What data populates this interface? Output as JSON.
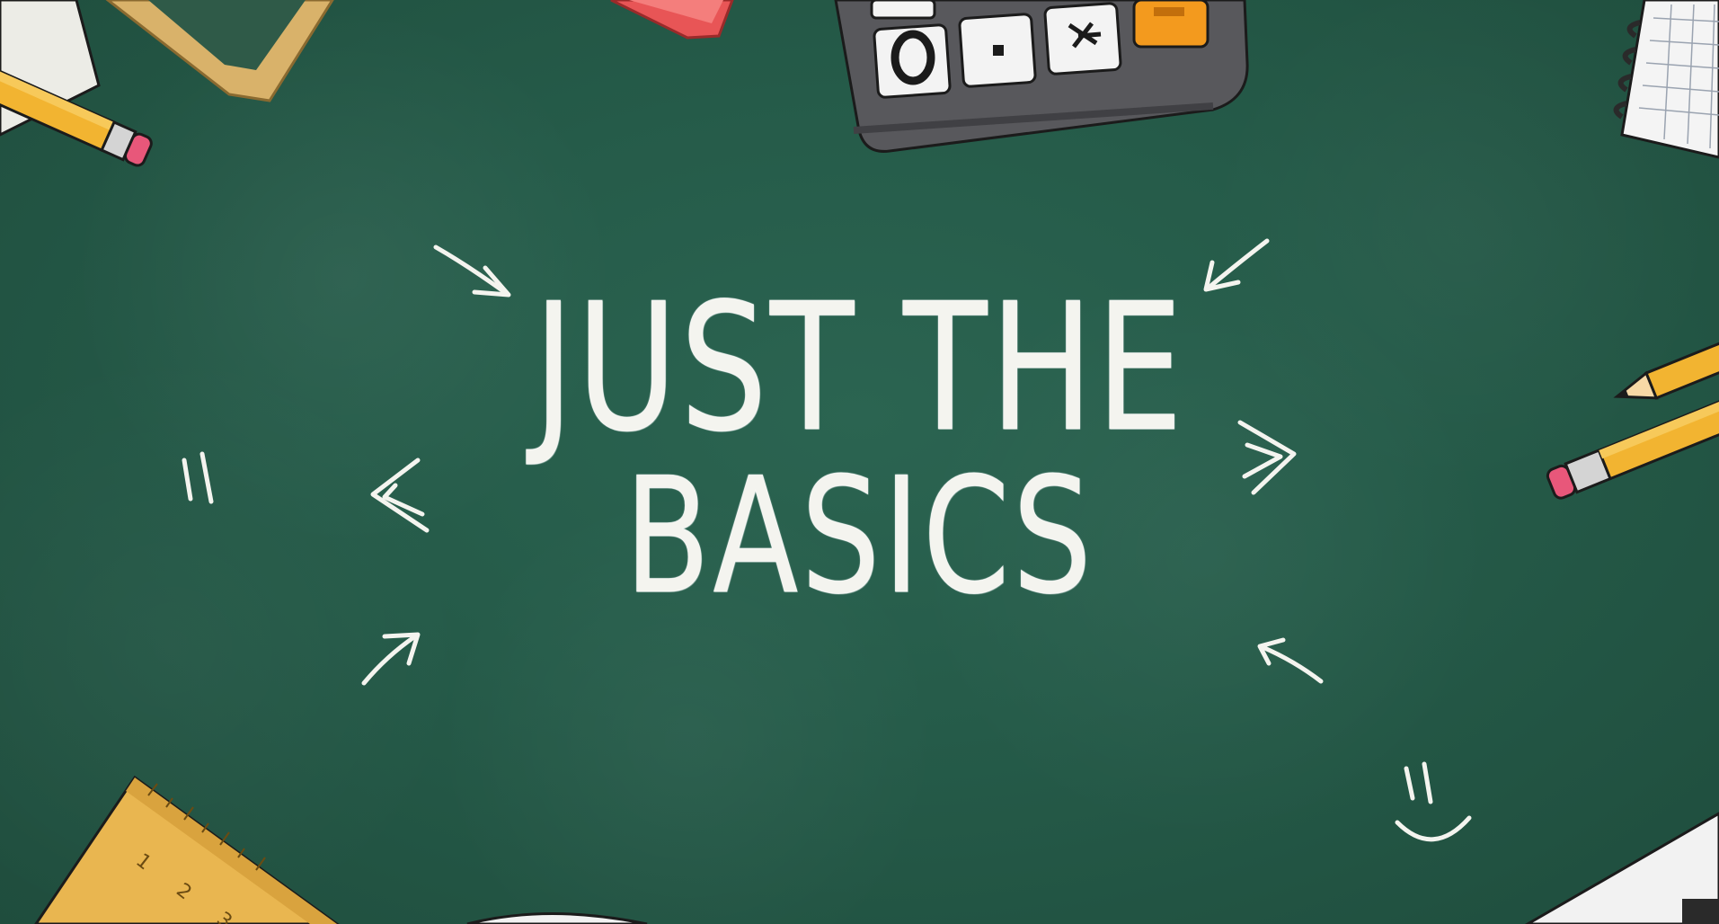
{
  "title": {
    "line1": "JUST THE",
    "line2": "BASICS"
  },
  "decorations": {
    "calculator_keys": [
      "0",
      "",
      "",
      ""
    ],
    "ruler_numbers": [
      "1",
      "2",
      "3"
    ]
  },
  "colors": {
    "chalkboard": "#245546",
    "chalk": "#f4f4ef",
    "pencil": "#f2b431",
    "eraser": "#e8577a",
    "calculator_body": "#5a5a5e",
    "calculator_accent": "#f39a1e",
    "ruler": "#e9b650"
  },
  "icons": [
    "pencil-icon",
    "calculator-icon",
    "ruler-icon",
    "notebook-icon",
    "smiley-icon",
    "arrow-icon"
  ]
}
